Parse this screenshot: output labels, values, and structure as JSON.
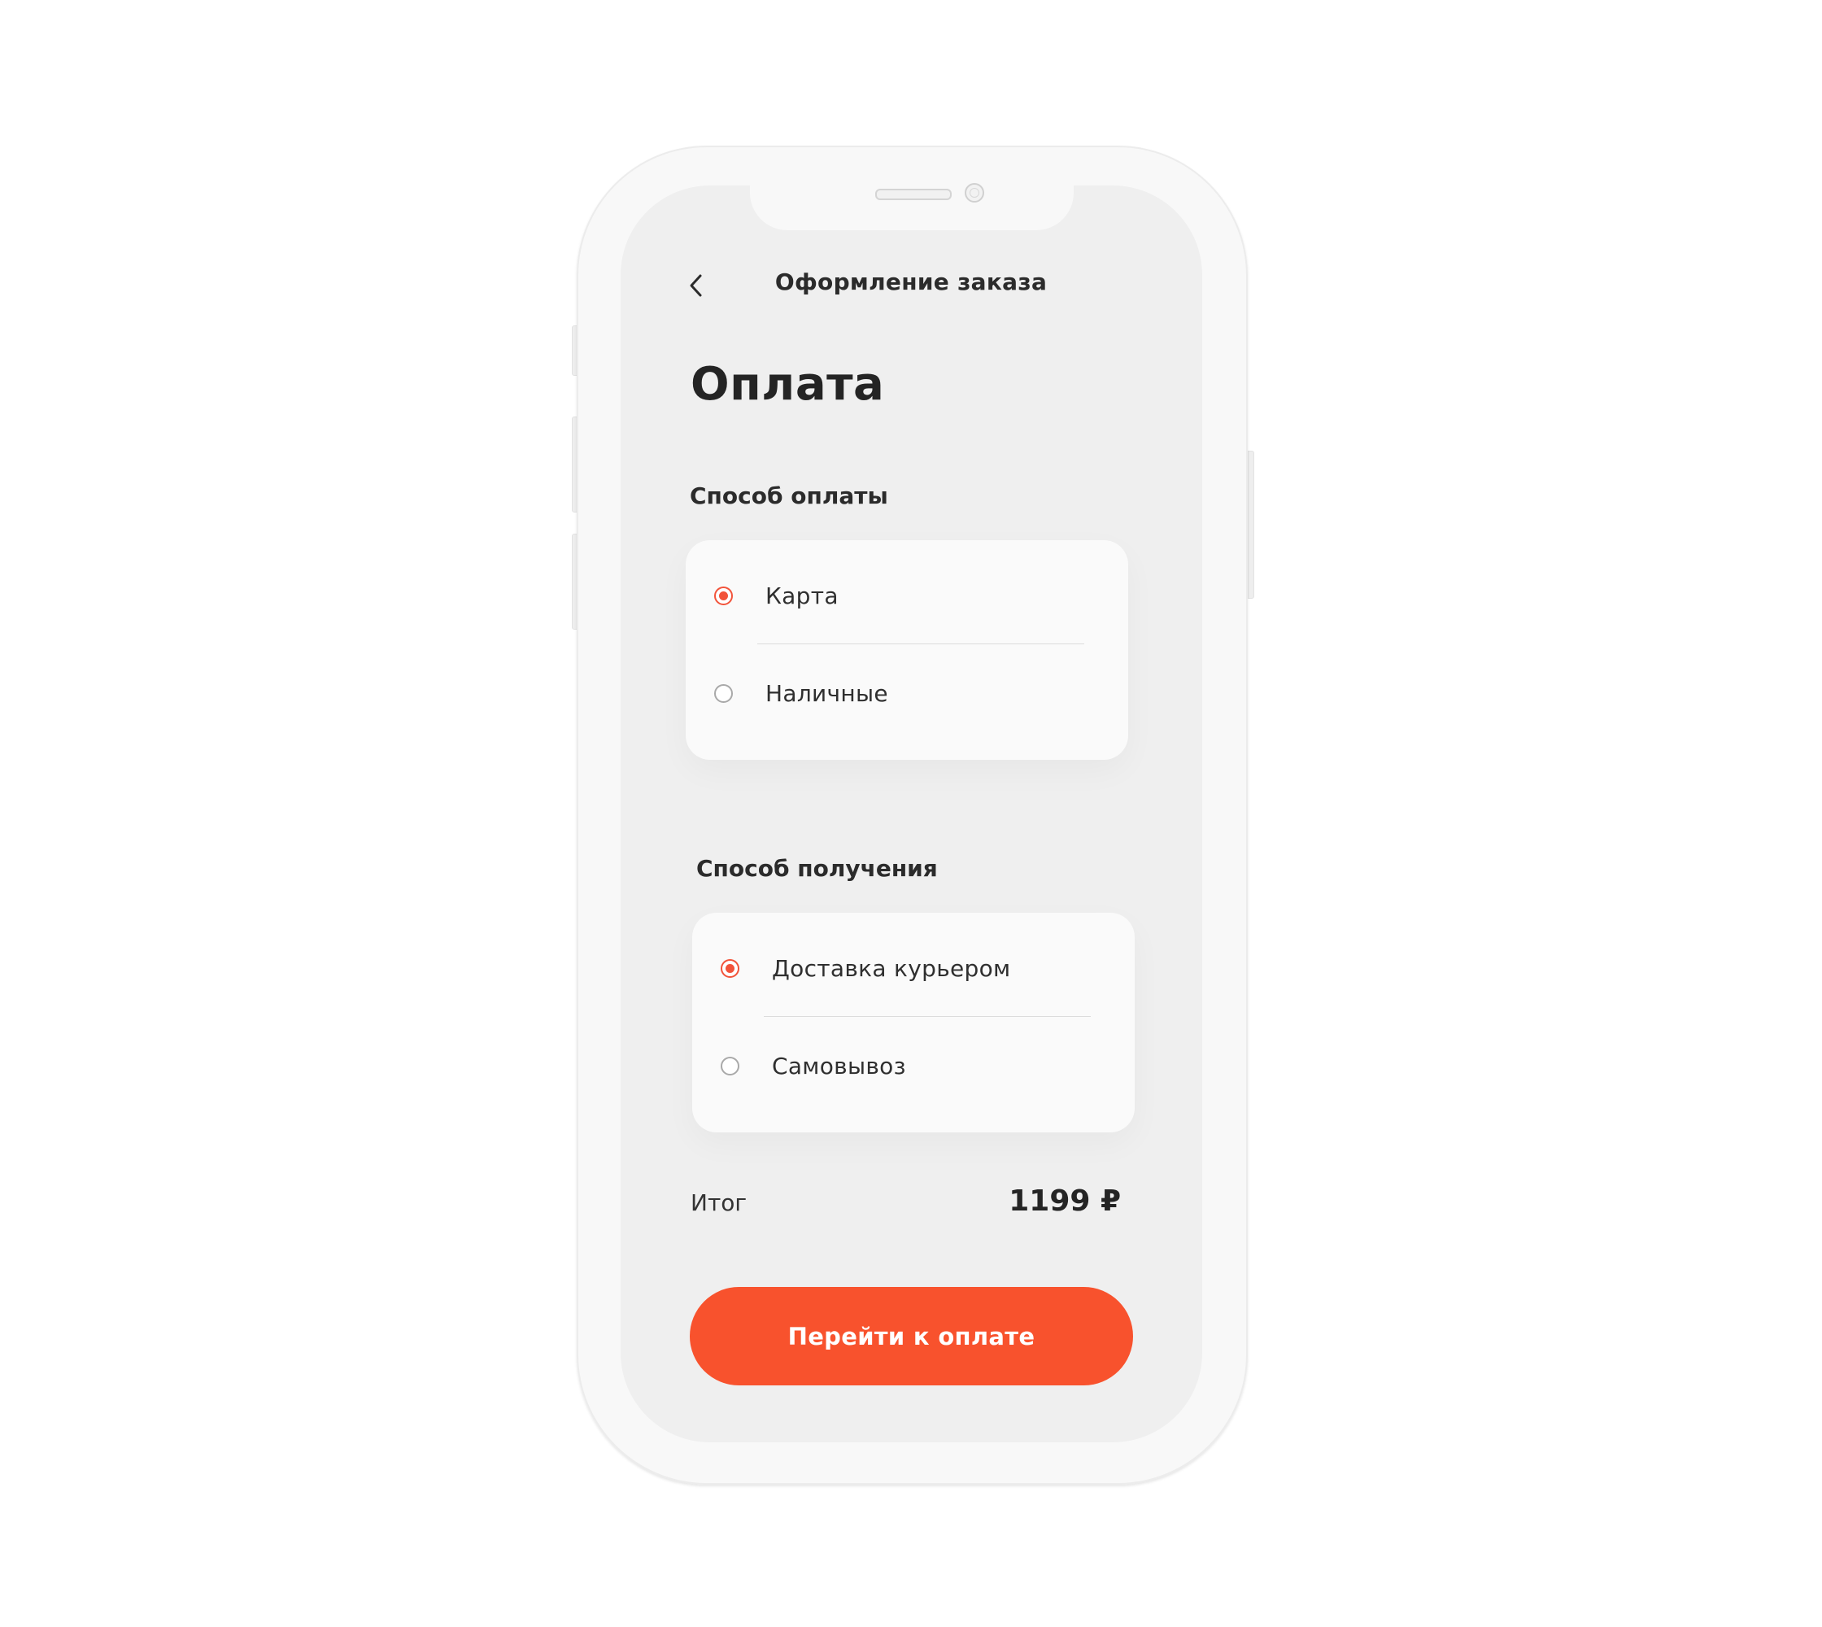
{
  "header": {
    "title": "Оформление заказа",
    "back_icon": "chevron-left-icon"
  },
  "page": {
    "title": "Оплата"
  },
  "payment": {
    "label": "Способ оплаты",
    "options": [
      {
        "label": "Карта",
        "selected": true
      },
      {
        "label": "Наличные",
        "selected": false
      }
    ]
  },
  "delivery": {
    "label": "Способ получения",
    "options": [
      {
        "label": "Доставка курьером",
        "selected": true
      },
      {
        "label": "Самовывоз",
        "selected": false
      }
    ]
  },
  "summary": {
    "total_label": "Итог",
    "total_value": "1199 ₽"
  },
  "actions": {
    "pay_label": "Перейти к оплате"
  },
  "colors": {
    "accent": "#f8522d",
    "radio_selected": "#f2533a",
    "screen_bg": "#efefef",
    "card_bg": "#fafafa"
  }
}
